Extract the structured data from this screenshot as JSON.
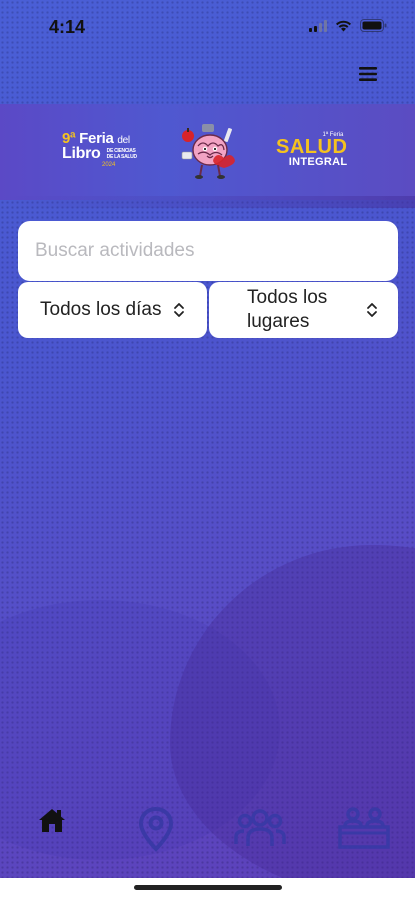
{
  "status_bar": {
    "time": "4:14",
    "icons": [
      "cellular-signal-icon",
      "wifi-icon",
      "battery-icon"
    ]
  },
  "header": {
    "menu_icon": "hamburger-menu-icon"
  },
  "banner": {
    "feria_logo": {
      "number": "9ª",
      "word1": "Feria",
      "word2": "del",
      "word3": "Libro",
      "subtitle_line1": "DE CIENCIAS",
      "subtitle_line2": "DE LA SALUD",
      "year": "2024"
    },
    "mascot_icon": "brain-mascot-icon",
    "salud_logo": {
      "tag": "1ª Feria",
      "big": "SALUD",
      "small": "INTEGRAL"
    }
  },
  "search": {
    "placeholder": "Buscar actividades",
    "value": ""
  },
  "filters": {
    "days": {
      "selected": "Todos los días"
    },
    "places": {
      "selected": "Todos los lugares"
    }
  },
  "tabbar": {
    "items": [
      {
        "icon": "home-icon",
        "active": true
      },
      {
        "icon": "map-pin-icon",
        "active": false
      },
      {
        "icon": "people-group-icon",
        "active": false
      },
      {
        "icon": "exhibitors-icon",
        "active": false
      }
    ]
  },
  "colors": {
    "background_top": "#4a5fd6",
    "background_bottom": "#5d3fb8",
    "accent_yellow": "#f4c21f",
    "tab_active": "#111111",
    "tab_inactive": "#3a39a6"
  }
}
